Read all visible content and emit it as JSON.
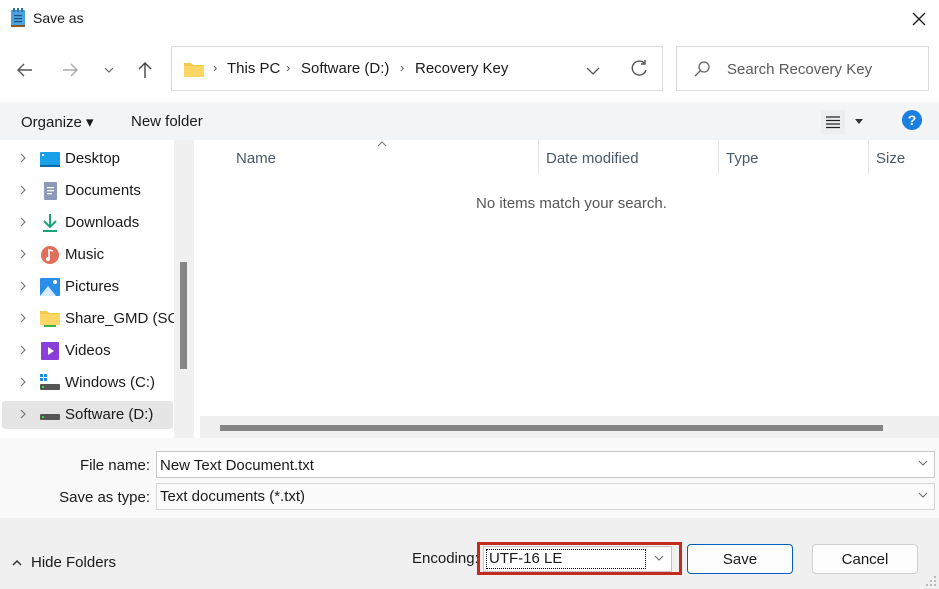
{
  "window": {
    "title": "Save as",
    "app_icon": "notepad-icon",
    "close_icon": "close-icon"
  },
  "nav": {
    "back_icon": "arrow-left-icon",
    "forward_icon": "arrow-right-icon",
    "recent_icon": "chevron-down-icon",
    "up_icon": "arrow-up-icon"
  },
  "address": {
    "crumbs": [
      "This PC",
      "Software (D:)",
      "Recovery Key"
    ],
    "separator": "›",
    "refresh_icon": "refresh-icon"
  },
  "search": {
    "placeholder": "Search Recovery Key"
  },
  "toolbar": {
    "organize_label": "Organize ▾",
    "new_folder_label": "New folder",
    "view_icon": "list-view-icon",
    "help_icon": "help-icon"
  },
  "sidebar": {
    "items": [
      {
        "label": "Desktop",
        "icon": "desktop-icon"
      },
      {
        "label": "Documents",
        "icon": "documents-icon"
      },
      {
        "label": "Downloads",
        "icon": "downloads-icon"
      },
      {
        "label": "Music",
        "icon": "music-icon"
      },
      {
        "label": "Pictures",
        "icon": "pictures-icon"
      },
      {
        "label": "Share_GMD (SC-",
        "icon": "network-folder-icon"
      },
      {
        "label": "Videos",
        "icon": "videos-icon"
      },
      {
        "label": "Windows (C:)",
        "icon": "windows-drive-icon"
      },
      {
        "label": "Software (D:)",
        "icon": "drive-icon",
        "selected": true
      }
    ]
  },
  "file_list": {
    "columns": [
      "Name",
      "Date modified",
      "Type",
      "Size"
    ],
    "sort_column": "Name",
    "empty_message": "No items match your search.",
    "rows": []
  },
  "form": {
    "file_name_label": "File name:",
    "file_name_value": "New Text Document.txt",
    "save_as_type_label": "Save as type:",
    "save_as_type_value": "Text documents (*.txt)"
  },
  "footer": {
    "hide_folders_label": "Hide Folders",
    "encoding_label": "Encoding:",
    "encoding_value": "UTF-16 LE",
    "save_label": "Save",
    "cancel_label": "Cancel",
    "highlight_color": "#c42b1c"
  }
}
